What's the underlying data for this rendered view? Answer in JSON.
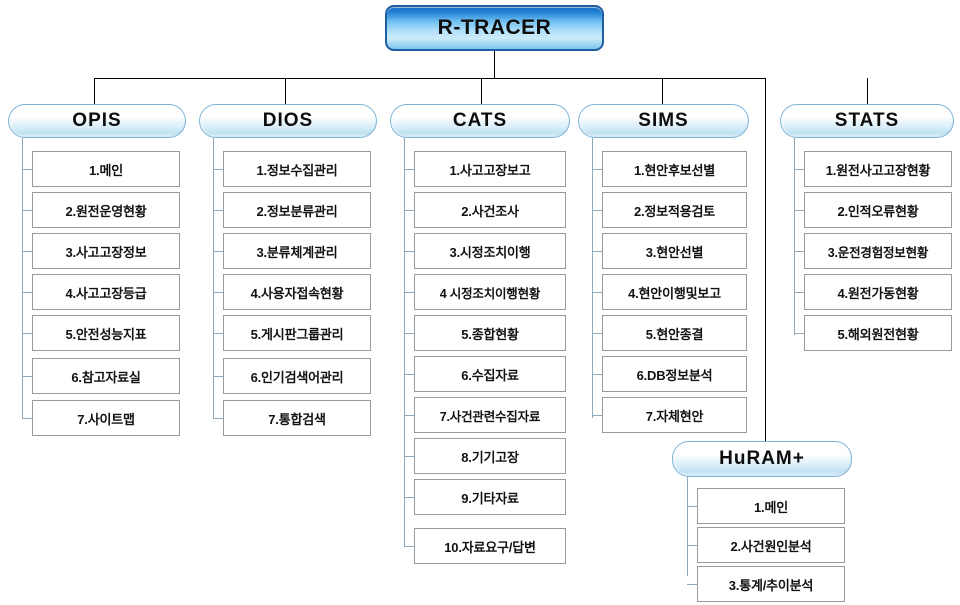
{
  "diagram": {
    "title": "R-TRACER system structure chart",
    "root": {
      "label": "R-TRACER"
    },
    "colors": {
      "root_border": "#1f5fa0",
      "root_fill": "#1f7fd4",
      "header_border": "#7fb4d6",
      "leaf_border": "#9a9a9a",
      "connector": "#000000",
      "tree_connector": "#8fa9bd"
    },
    "sections": [
      {
        "id": "opis",
        "label": "OPIS",
        "items": [
          {
            "label": "1.메인"
          },
          {
            "label": "2.원전운영현황"
          },
          {
            "label": "3.사고고장정보"
          },
          {
            "label": "4.사고고장등급"
          },
          {
            "label": "5.안전성능지표"
          },
          {
            "label": "6.참고자료실"
          },
          {
            "label": "7.사이트맵"
          }
        ]
      },
      {
        "id": "dios",
        "label": "DIOS",
        "items": [
          {
            "label": "1.정보수집관리"
          },
          {
            "label": "2.정보분류관리"
          },
          {
            "label": "3.분류체계관리"
          },
          {
            "label": "4.사용자접속현황"
          },
          {
            "label": "5.게시판그룹관리"
          },
          {
            "label": "6.인기검색어관리"
          },
          {
            "label": "7.통합검색"
          }
        ]
      },
      {
        "id": "cats",
        "label": "CATS",
        "items": [
          {
            "label": "1.사고고장보고"
          },
          {
            "label": "2.사건조사"
          },
          {
            "label": "3.시정조치이행"
          },
          {
            "label": "4 시정조치이행현황"
          },
          {
            "label": "5.종합현황"
          },
          {
            "label": "6.수집자료"
          },
          {
            "label": "7.사건관련수집자료"
          },
          {
            "label": "8.기기고장"
          },
          {
            "label": "9.기타자료"
          },
          {
            "label": "10.자료요구/답변"
          }
        ]
      },
      {
        "id": "sims",
        "label": "SIMS",
        "items": [
          {
            "label": "1.현안후보선별"
          },
          {
            "label": "2.정보적용검토"
          },
          {
            "label": "3.현안선별"
          },
          {
            "label": "4.현안이행및보고"
          },
          {
            "label": "5.현안종결"
          },
          {
            "label": "6.DB정보분석"
          },
          {
            "label": "7.자체현안"
          }
        ]
      },
      {
        "id": "stats",
        "label": "STATS",
        "items": [
          {
            "label": "1.원전사고고장현황"
          },
          {
            "label": "2.인적오류현황"
          },
          {
            "label": "3.운전경험정보현황"
          },
          {
            "label": "4.원전가동현황"
          },
          {
            "label": "5.해외원전현황"
          }
        ]
      },
      {
        "id": "huram",
        "label": "HuRAM+",
        "items": [
          {
            "label": "1.메인"
          },
          {
            "label": "2.사건원인분석"
          },
          {
            "label": "3.통계/추이분석"
          }
        ]
      }
    ]
  }
}
